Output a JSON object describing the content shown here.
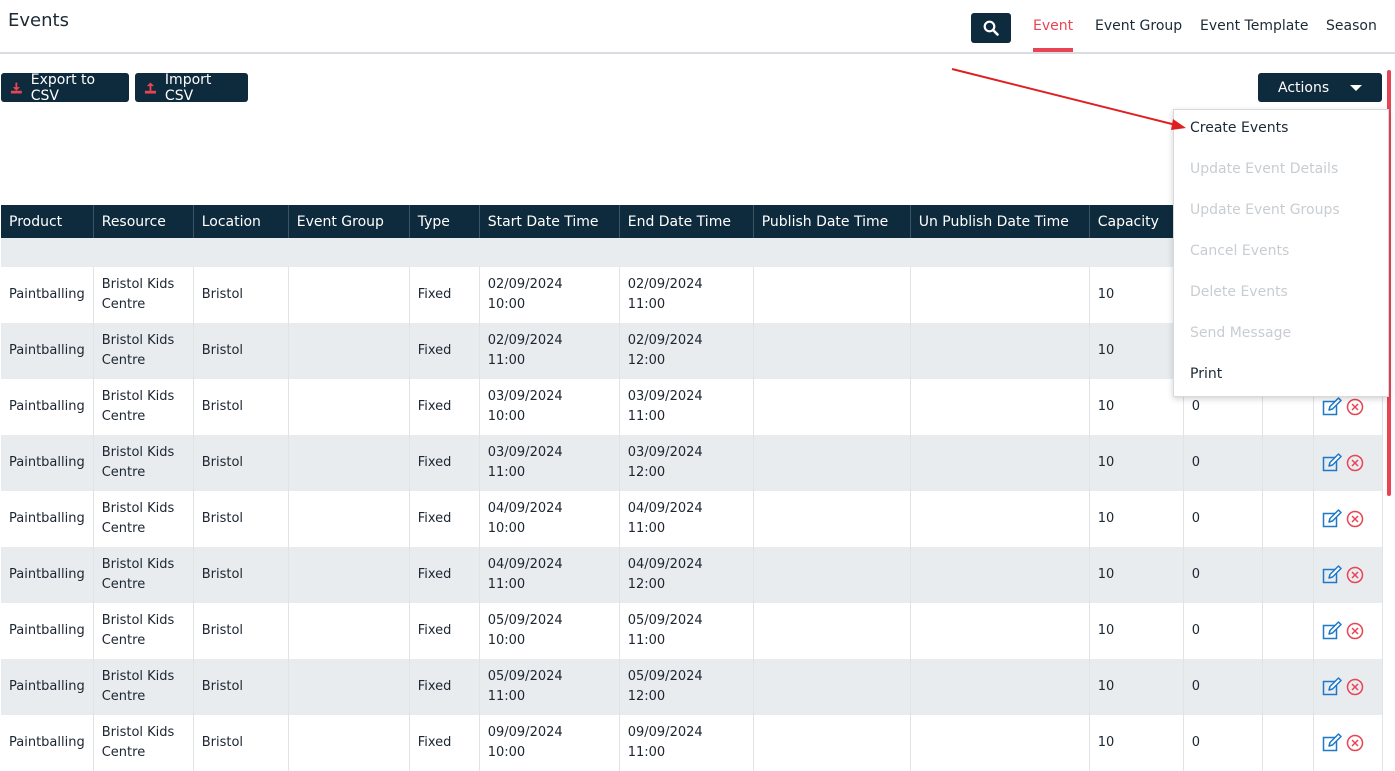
{
  "page": {
    "title": "Events"
  },
  "nav": {
    "tabs": [
      {
        "label": "Event",
        "active": true
      },
      {
        "label": "Event Group",
        "active": false
      },
      {
        "label": "Event Template",
        "active": false
      },
      {
        "label": "Season",
        "active": false
      }
    ]
  },
  "toolbar": {
    "export_label": "Export to CSV",
    "import_label": "Import CSV",
    "actions_label": "Actions"
  },
  "actions_menu": {
    "items": [
      {
        "label": "Create Events",
        "enabled": true
      },
      {
        "label": "Update Event Details",
        "enabled": false
      },
      {
        "label": "Update Event Groups",
        "enabled": false
      },
      {
        "label": "Cancel Events",
        "enabled": false
      },
      {
        "label": "Delete Events",
        "enabled": false
      },
      {
        "label": "Send Message",
        "enabled": false
      },
      {
        "label": "Print",
        "enabled": true
      }
    ]
  },
  "table": {
    "columns": [
      "Product",
      "Resource",
      "Location",
      "Event Group",
      "Type",
      "Start Date Time",
      "End Date Time",
      "Publish Date Time",
      "Un Publish Date Time",
      "Capacity",
      "",
      "",
      ""
    ],
    "rows": [
      {
        "product": "Paintballing",
        "resource": "Bristol Kids Centre",
        "location": "Bristol",
        "event_group": "",
        "type": "Fixed",
        "start_date": "02/09/2024",
        "start_time": "10:00",
        "end_date": "02/09/2024",
        "end_time": "11:00",
        "publish": "",
        "unpublish": "",
        "capacity": "10",
        "booked": ""
      },
      {
        "product": "Paintballing",
        "resource": "Bristol Kids Centre",
        "location": "Bristol",
        "event_group": "",
        "type": "Fixed",
        "start_date": "02/09/2024",
        "start_time": "11:00",
        "end_date": "02/09/2024",
        "end_time": "12:00",
        "publish": "",
        "unpublish": "",
        "capacity": "10",
        "booked": ""
      },
      {
        "product": "Paintballing",
        "resource": "Bristol Kids Centre",
        "location": "Bristol",
        "event_group": "",
        "type": "Fixed",
        "start_date": "03/09/2024",
        "start_time": "10:00",
        "end_date": "03/09/2024",
        "end_time": "11:00",
        "publish": "",
        "unpublish": "",
        "capacity": "10",
        "booked": "0"
      },
      {
        "product": "Paintballing",
        "resource": "Bristol Kids Centre",
        "location": "Bristol",
        "event_group": "",
        "type": "Fixed",
        "start_date": "03/09/2024",
        "start_time": "11:00",
        "end_date": "03/09/2024",
        "end_time": "12:00",
        "publish": "",
        "unpublish": "",
        "capacity": "10",
        "booked": "0"
      },
      {
        "product": "Paintballing",
        "resource": "Bristol Kids Centre",
        "location": "Bristol",
        "event_group": "",
        "type": "Fixed",
        "start_date": "04/09/2024",
        "start_time": "10:00",
        "end_date": "04/09/2024",
        "end_time": "11:00",
        "publish": "",
        "unpublish": "",
        "capacity": "10",
        "booked": "0"
      },
      {
        "product": "Paintballing",
        "resource": "Bristol Kids Centre",
        "location": "Bristol",
        "event_group": "",
        "type": "Fixed",
        "start_date": "04/09/2024",
        "start_time": "11:00",
        "end_date": "04/09/2024",
        "end_time": "12:00",
        "publish": "",
        "unpublish": "",
        "capacity": "10",
        "booked": "0"
      },
      {
        "product": "Paintballing",
        "resource": "Bristol Kids Centre",
        "location": "Bristol",
        "event_group": "",
        "type": "Fixed",
        "start_date": "05/09/2024",
        "start_time": "10:00",
        "end_date": "05/09/2024",
        "end_time": "11:00",
        "publish": "",
        "unpublish": "",
        "capacity": "10",
        "booked": "0"
      },
      {
        "product": "Paintballing",
        "resource": "Bristol Kids Centre",
        "location": "Bristol",
        "event_group": "",
        "type": "Fixed",
        "start_date": "05/09/2024",
        "start_time": "11:00",
        "end_date": "05/09/2024",
        "end_time": "12:00",
        "publish": "",
        "unpublish": "",
        "capacity": "10",
        "booked": "0"
      },
      {
        "product": "Paintballing",
        "resource": "Bristol Kids Centre",
        "location": "Bristol",
        "event_group": "",
        "type": "Fixed",
        "start_date": "09/09/2024",
        "start_time": "10:00",
        "end_date": "09/09/2024",
        "end_time": "11:00",
        "publish": "",
        "unpublish": "",
        "capacity": "10",
        "booked": "0"
      }
    ]
  },
  "icons": {
    "search": "search-icon",
    "export": "download-icon",
    "import": "upload-icon",
    "edit": "edit-icon",
    "delete": "cancel-circle-icon"
  },
  "colors": {
    "navy": "#0e2a3d",
    "accent": "#e84454",
    "edit_icon": "#1e78c8",
    "delete_icon": "#e84454",
    "annotation_arrow": "#e02020"
  }
}
